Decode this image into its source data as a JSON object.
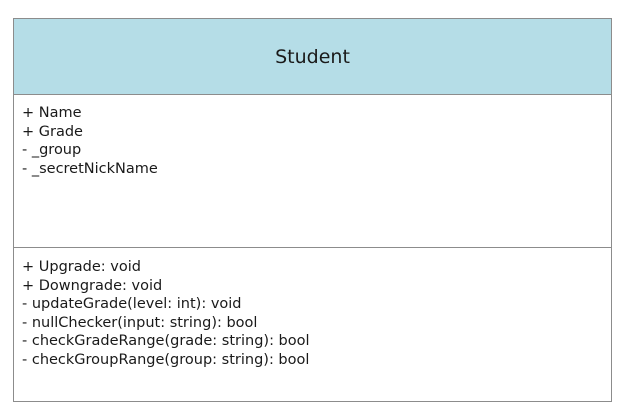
{
  "class": {
    "name": "Student",
    "attributes": [
      "+ Name",
      "+ Grade",
      "- _group",
      "- _secretNickName"
    ],
    "operations": [
      "+ Upgrade: void",
      "+ Downgrade: void",
      "- updateGrade(level: int): void",
      "- nullChecker(input: string): bool",
      "- checkGradeRange(grade: string): bool",
      "- checkGroupRange(group: string): bool"
    ]
  },
  "colors": {
    "header_fill": "#b5dde7",
    "border": "#8c8c8c",
    "text": "#1a1a1a"
  }
}
